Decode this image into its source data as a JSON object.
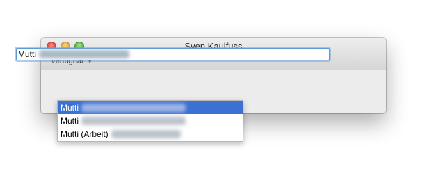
{
  "window": {
    "title": "Sven Kaulfuss",
    "status_label": "Verfügbar",
    "status_chevron_icon": "chevron-down-icon"
  },
  "search": {
    "value": "Mutti"
  },
  "suggestions": [
    {
      "label": "Mutti",
      "selected": true
    },
    {
      "label": "Mutti",
      "selected": false
    },
    {
      "label": "Mutti (Arbeit)",
      "selected": false
    }
  ],
  "colors": {
    "selection": "#3c71d4",
    "focus_ring": "#5b9ad9"
  }
}
